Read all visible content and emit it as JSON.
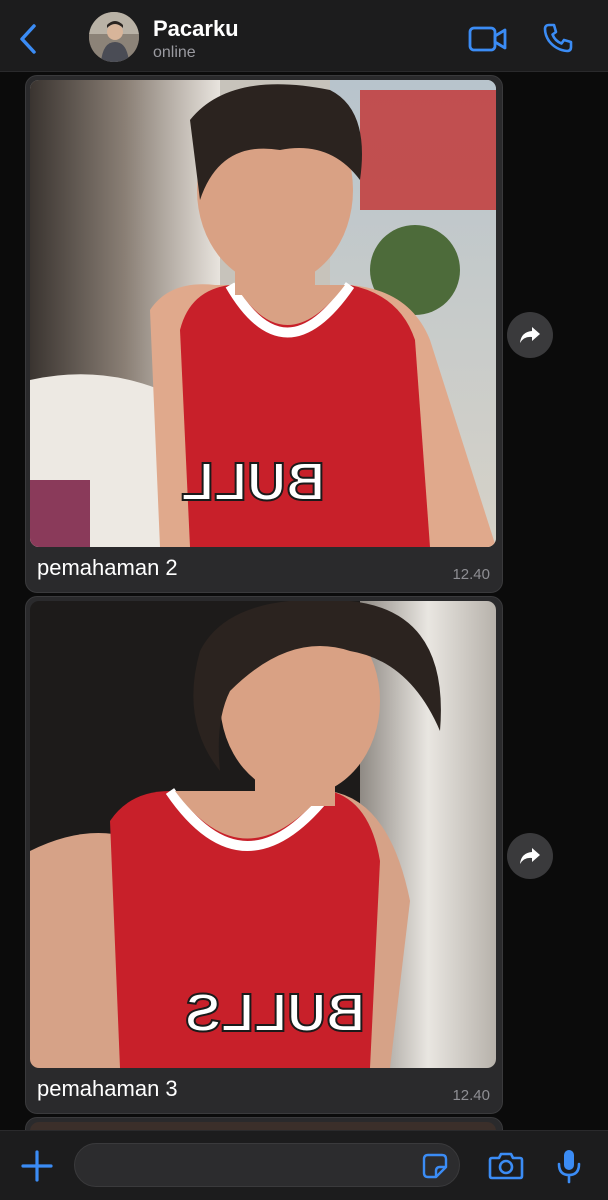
{
  "header": {
    "contact_name": "Pacarku",
    "status": "online",
    "icons": [
      "chevron-left-icon",
      "video-camera-icon",
      "phone-icon"
    ],
    "accent_color": "#3b8cf5"
  },
  "messages": [
    {
      "caption": "pemahaman 2",
      "time": "12.40",
      "media": "photo"
    },
    {
      "caption": "pemahaman 3",
      "time": "12.40",
      "media": "photo"
    }
  ],
  "input_bar": {
    "placeholder": "",
    "icons": [
      "plus-icon",
      "sticker-icon",
      "camera-icon",
      "microphone-icon"
    ]
  }
}
